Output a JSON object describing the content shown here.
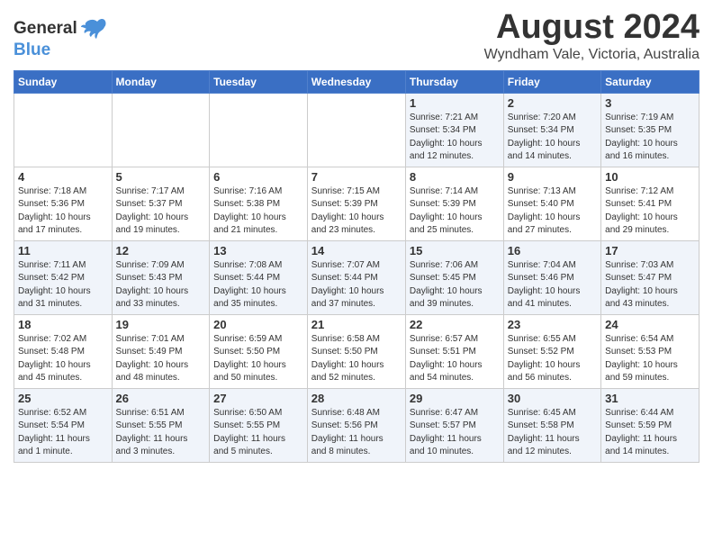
{
  "header": {
    "logo": {
      "general": "General",
      "blue": "Blue"
    },
    "title": "August 2024",
    "location": "Wyndham Vale, Victoria, Australia"
  },
  "calendar": {
    "days_of_week": [
      "Sunday",
      "Monday",
      "Tuesday",
      "Wednesday",
      "Thursday",
      "Friday",
      "Saturday"
    ],
    "weeks": [
      [
        {
          "day": "",
          "info": ""
        },
        {
          "day": "",
          "info": ""
        },
        {
          "day": "",
          "info": ""
        },
        {
          "day": "",
          "info": ""
        },
        {
          "day": "1",
          "info": "Sunrise: 7:21 AM\nSunset: 5:34 PM\nDaylight: 10 hours\nand 12 minutes."
        },
        {
          "day": "2",
          "info": "Sunrise: 7:20 AM\nSunset: 5:34 PM\nDaylight: 10 hours\nand 14 minutes."
        },
        {
          "day": "3",
          "info": "Sunrise: 7:19 AM\nSunset: 5:35 PM\nDaylight: 10 hours\nand 16 minutes."
        }
      ],
      [
        {
          "day": "4",
          "info": "Sunrise: 7:18 AM\nSunset: 5:36 PM\nDaylight: 10 hours\nand 17 minutes."
        },
        {
          "day": "5",
          "info": "Sunrise: 7:17 AM\nSunset: 5:37 PM\nDaylight: 10 hours\nand 19 minutes."
        },
        {
          "day": "6",
          "info": "Sunrise: 7:16 AM\nSunset: 5:38 PM\nDaylight: 10 hours\nand 21 minutes."
        },
        {
          "day": "7",
          "info": "Sunrise: 7:15 AM\nSunset: 5:39 PM\nDaylight: 10 hours\nand 23 minutes."
        },
        {
          "day": "8",
          "info": "Sunrise: 7:14 AM\nSunset: 5:39 PM\nDaylight: 10 hours\nand 25 minutes."
        },
        {
          "day": "9",
          "info": "Sunrise: 7:13 AM\nSunset: 5:40 PM\nDaylight: 10 hours\nand 27 minutes."
        },
        {
          "day": "10",
          "info": "Sunrise: 7:12 AM\nSunset: 5:41 PM\nDaylight: 10 hours\nand 29 minutes."
        }
      ],
      [
        {
          "day": "11",
          "info": "Sunrise: 7:11 AM\nSunset: 5:42 PM\nDaylight: 10 hours\nand 31 minutes."
        },
        {
          "day": "12",
          "info": "Sunrise: 7:09 AM\nSunset: 5:43 PM\nDaylight: 10 hours\nand 33 minutes."
        },
        {
          "day": "13",
          "info": "Sunrise: 7:08 AM\nSunset: 5:44 PM\nDaylight: 10 hours\nand 35 minutes."
        },
        {
          "day": "14",
          "info": "Sunrise: 7:07 AM\nSunset: 5:44 PM\nDaylight: 10 hours\nand 37 minutes."
        },
        {
          "day": "15",
          "info": "Sunrise: 7:06 AM\nSunset: 5:45 PM\nDaylight: 10 hours\nand 39 minutes."
        },
        {
          "day": "16",
          "info": "Sunrise: 7:04 AM\nSunset: 5:46 PM\nDaylight: 10 hours\nand 41 minutes."
        },
        {
          "day": "17",
          "info": "Sunrise: 7:03 AM\nSunset: 5:47 PM\nDaylight: 10 hours\nand 43 minutes."
        }
      ],
      [
        {
          "day": "18",
          "info": "Sunrise: 7:02 AM\nSunset: 5:48 PM\nDaylight: 10 hours\nand 45 minutes."
        },
        {
          "day": "19",
          "info": "Sunrise: 7:01 AM\nSunset: 5:49 PM\nDaylight: 10 hours\nand 48 minutes."
        },
        {
          "day": "20",
          "info": "Sunrise: 6:59 AM\nSunset: 5:50 PM\nDaylight: 10 hours\nand 50 minutes."
        },
        {
          "day": "21",
          "info": "Sunrise: 6:58 AM\nSunset: 5:50 PM\nDaylight: 10 hours\nand 52 minutes."
        },
        {
          "day": "22",
          "info": "Sunrise: 6:57 AM\nSunset: 5:51 PM\nDaylight: 10 hours\nand 54 minutes."
        },
        {
          "day": "23",
          "info": "Sunrise: 6:55 AM\nSunset: 5:52 PM\nDaylight: 10 hours\nand 56 minutes."
        },
        {
          "day": "24",
          "info": "Sunrise: 6:54 AM\nSunset: 5:53 PM\nDaylight: 10 hours\nand 59 minutes."
        }
      ],
      [
        {
          "day": "25",
          "info": "Sunrise: 6:52 AM\nSunset: 5:54 PM\nDaylight: 11 hours\nand 1 minute."
        },
        {
          "day": "26",
          "info": "Sunrise: 6:51 AM\nSunset: 5:55 PM\nDaylight: 11 hours\nand 3 minutes."
        },
        {
          "day": "27",
          "info": "Sunrise: 6:50 AM\nSunset: 5:55 PM\nDaylight: 11 hours\nand 5 minutes."
        },
        {
          "day": "28",
          "info": "Sunrise: 6:48 AM\nSunset: 5:56 PM\nDaylight: 11 hours\nand 8 minutes."
        },
        {
          "day": "29",
          "info": "Sunrise: 6:47 AM\nSunset: 5:57 PM\nDaylight: 11 hours\nand 10 minutes."
        },
        {
          "day": "30",
          "info": "Sunrise: 6:45 AM\nSunset: 5:58 PM\nDaylight: 11 hours\nand 12 minutes."
        },
        {
          "day": "31",
          "info": "Sunrise: 6:44 AM\nSunset: 5:59 PM\nDaylight: 11 hours\nand 14 minutes."
        }
      ]
    ]
  }
}
